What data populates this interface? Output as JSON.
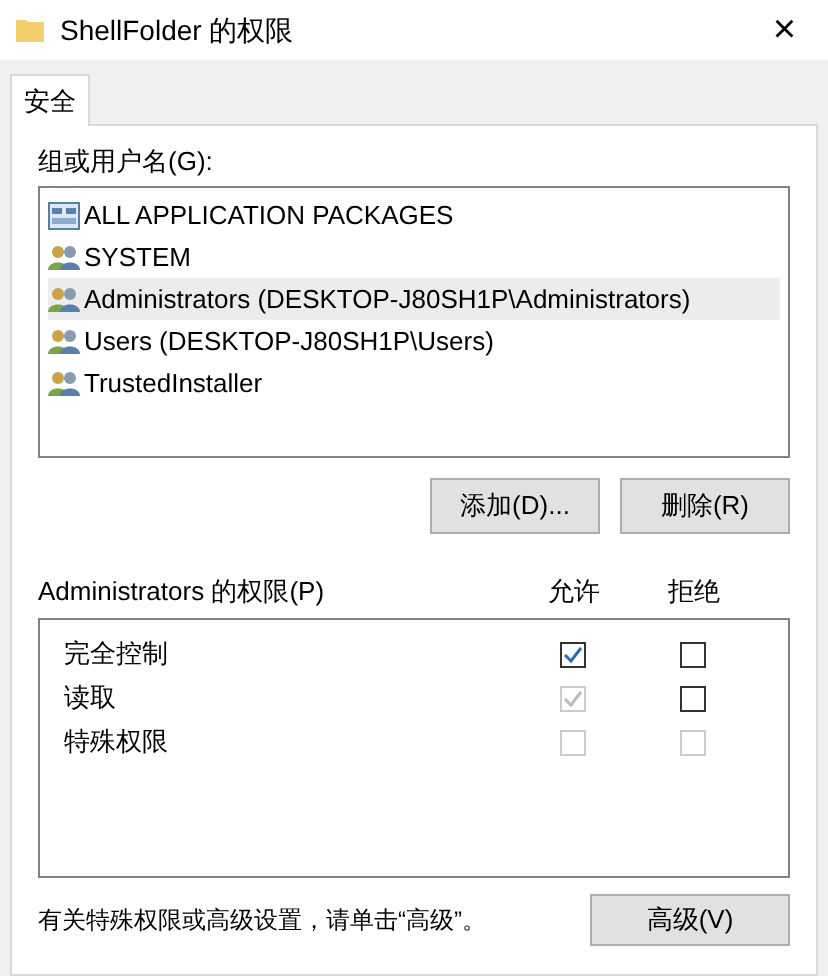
{
  "window": {
    "title": "ShellFolder 的权限",
    "close": "×"
  },
  "tabs": [
    {
      "label": "安全",
      "selected": true
    }
  ],
  "groups": {
    "label": "组或用户名(G):",
    "items": [
      {
        "name": "ALL APPLICATION PACKAGES",
        "kind": "package",
        "selected": false
      },
      {
        "name": "SYSTEM",
        "kind": "users",
        "selected": false
      },
      {
        "name": "Administrators (DESKTOP-J80SH1P\\Administrators)",
        "kind": "users",
        "selected": true
      },
      {
        "name": "Users (DESKTOP-J80SH1P\\Users)",
        "kind": "users",
        "selected": false
      },
      {
        "name": "TrustedInstaller",
        "kind": "users",
        "selected": false
      }
    ]
  },
  "group_buttons": [
    "添加(D)...",
    "删除(R)"
  ],
  "permissions": {
    "label": "Administrators 的权限(P)",
    "allow_heading": "允许",
    "deny_heading": "拒绝",
    "rows": [
      {
        "name": "完全控制",
        "allow": {
          "checked": true,
          "disabled": false
        },
        "deny": {
          "checked": false,
          "disabled": false
        }
      },
      {
        "name": "读取",
        "allow": {
          "checked": true,
          "disabled": true
        },
        "deny": {
          "checked": false,
          "disabled": false
        }
      },
      {
        "name": "特殊权限",
        "allow": {
          "checked": false,
          "disabled": true
        },
        "deny": {
          "checked": false,
          "disabled": true
        }
      }
    ]
  },
  "footer": {
    "text": "有关特殊权限或高级设置，请单击“高级”。",
    "button": "高级(V)"
  }
}
